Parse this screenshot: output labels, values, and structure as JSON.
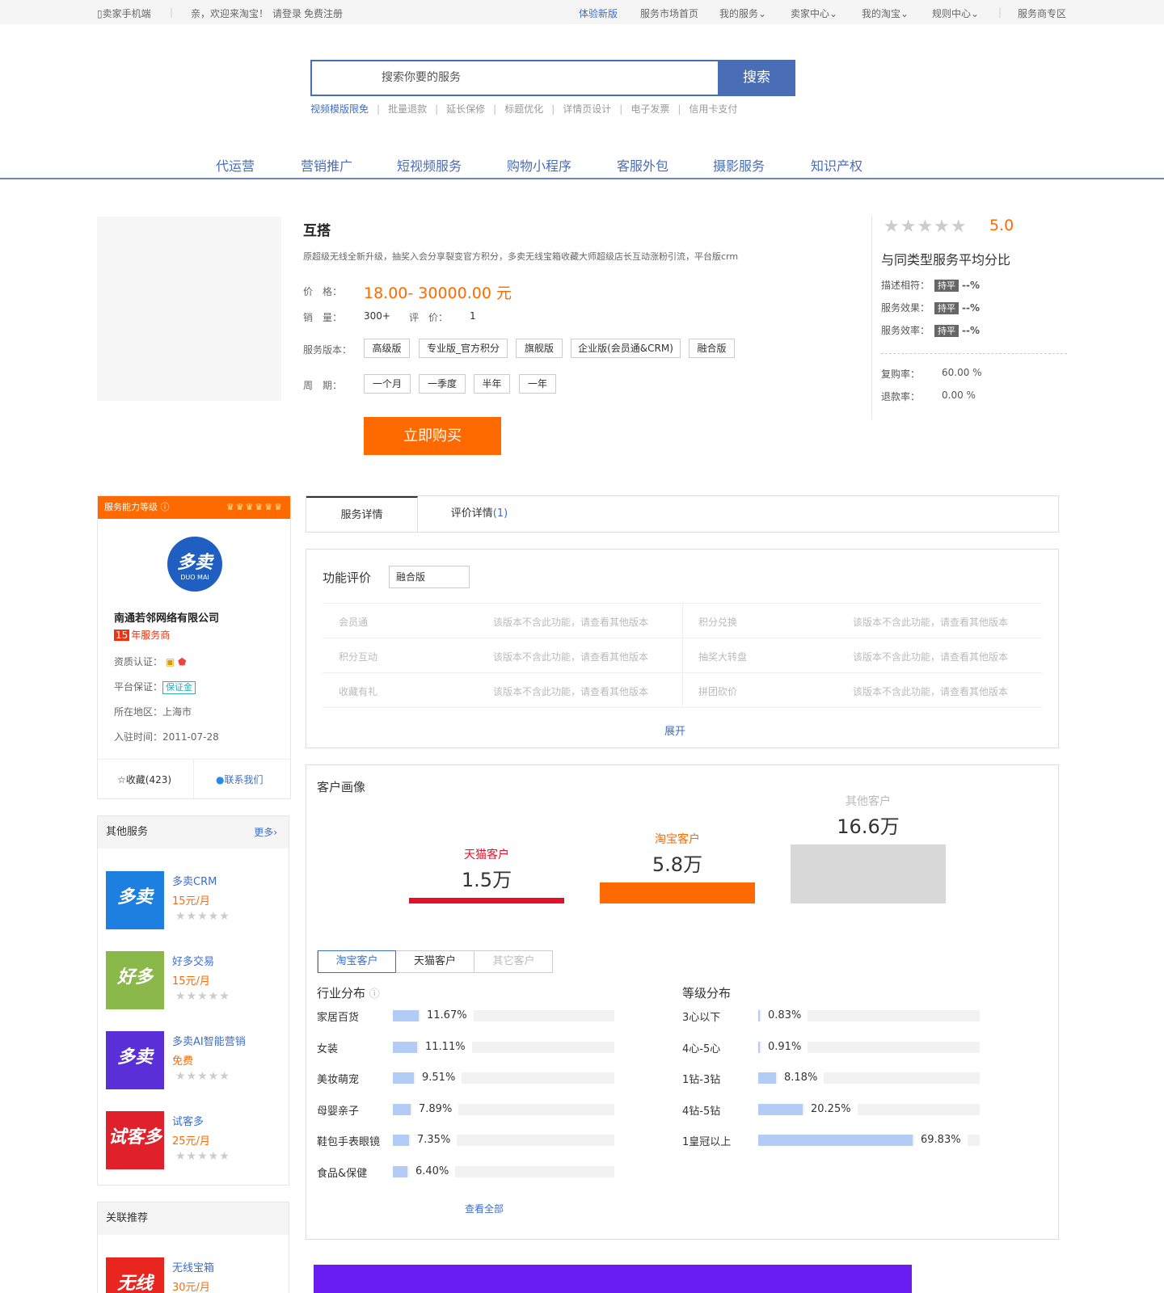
{
  "topbar": {
    "mobile": "卖家手机端",
    "welcome": "亲，欢迎来淘宝！",
    "login": "请登录",
    "register": "免费注册",
    "new_version": "体验新版",
    "market_home": "服务市场首页",
    "my_service": "我的服务",
    "seller_center": "卖家中心",
    "my_taobao": "我的淘宝",
    "rules": "规则中心",
    "provider_zone": "服务商专区"
  },
  "search": {
    "placeholder": "搜索你要的服务",
    "button": "搜索"
  },
  "hotwords": [
    "视频模版限免",
    "批量退款",
    "延长保修",
    "标题优化",
    "详情页设计",
    "电子发票",
    "信用卡支付"
  ],
  "categories": [
    "代运营",
    "营销推广",
    "短视频服务",
    "购物小程序",
    "客服外包",
    "摄影服务",
    "知识产权"
  ],
  "product": {
    "title": "互搭",
    "description": "原超级无线全新升级，抽奖入会分享裂变官方积分，多卖无线宝箱收藏大师超级店长互动涨粉引流，平台版crm",
    "price_label": "价　格：",
    "price": "18.00- 30000.00 元",
    "sales_label": "销　量：",
    "sales": "300+",
    "review_label": "评　价：",
    "reviews": "1",
    "version_label": "服务版本：",
    "versions": [
      "高级版",
      "专业版_官方积分",
      "旗舰版",
      "企业版(会员通&CRM)",
      "融合版"
    ],
    "period_label": "周　期：",
    "periods": [
      "一个月",
      "一季度",
      "半年",
      "一年"
    ],
    "buy_button": "立即购买"
  },
  "rating": {
    "stars": "★★★★★",
    "score": "5.0",
    "compare_title": "与同类型服务平均分比",
    "rows": [
      {
        "label": "描述相符：",
        "badge": "持平",
        "value": "--%"
      },
      {
        "label": "服务效果：",
        "badge": "持平",
        "value": "--%"
      },
      {
        "label": "服务效率：",
        "badge": "持平",
        "value": "--%"
      }
    ],
    "repurchase_label": "复购率：",
    "repurchase": "60.00 %",
    "refund_label": "退款率：",
    "refund": "0.00 %"
  },
  "provider": {
    "level_label": "服务能力等级",
    "logo_text": "多卖",
    "logo_sub": "DUO MAI",
    "company": "南通若邻网络有限公司",
    "years": "15",
    "years_suffix": "年服务商",
    "qualification_label": "资质认证：",
    "guarantee_label": "平台保证：",
    "guarantee_badge": "保证金",
    "region_label": "所在地区：",
    "region": "上海市",
    "joined_label": "入驻时间：",
    "joined": "2011-07-28",
    "favorite": "收藏(423)",
    "contact": "联系我们"
  },
  "other_services": {
    "title": "其他服务",
    "more": "更多›",
    "items": [
      {
        "name": "多卖CRM",
        "price": "15元/月",
        "stars": "★★★★★",
        "pic": "多卖",
        "color": "#1d7fe0"
      },
      {
        "name": "好多交易",
        "price": "15元/月",
        "stars": "★★★★★",
        "pic": "好多",
        "color": "#8ab84a"
      },
      {
        "name": "多卖AI智能营销",
        "price": "免费",
        "stars": "★★★★★",
        "pic": "多卖",
        "color": "#5a2fd8"
      },
      {
        "name": "试客多",
        "price": "25元/月",
        "stars": "★★★★★",
        "pic": "试客多",
        "color": "#e0202a"
      }
    ]
  },
  "related": {
    "title": "关联推荐",
    "items": [
      {
        "name": "无线宝箱",
        "price": "30元/月",
        "pic": "无线",
        "color": "#e8261f"
      }
    ]
  },
  "tabs": {
    "detail": "服务详情",
    "reviews": "评价详情",
    "review_count": "(1)"
  },
  "function_review": {
    "title": "功能评价",
    "selected_version": "融合版",
    "rows": [
      [
        {
          "name": "会员通",
          "note": "该版本不含此功能，请查看其他版本"
        },
        {
          "name": "积分兑换",
          "note": "该版本不含此功能，请查看其他版本"
        }
      ],
      [
        {
          "name": "积分互动",
          "note": "该版本不含此功能，请查看其他版本"
        },
        {
          "name": "抽奖大转盘",
          "note": "该版本不含此功能，请查看其他版本"
        }
      ],
      [
        {
          "name": "收藏有礼",
          "note": "该版本不含此功能，请查看其他版本"
        },
        {
          "name": "拼团砍价",
          "note": "该版本不含此功能，请查看其他版本"
        }
      ]
    ],
    "expand": "展开"
  },
  "persona": {
    "title": "客户画像",
    "tabs": [
      "淘宝客户",
      "天猫客户",
      "其它客户"
    ],
    "industry_title": "行业分布",
    "level_title": "等级分布",
    "view_all": "查看全部"
  },
  "colors": {
    "accent": "#ff6a00",
    "brand_blue": "#4a6eb5",
    "link": "#3b6ecf",
    "tmall_red": "#e60f28",
    "bar_blue": "#b3ccf5"
  },
  "chart_data": [
    {
      "type": "bar",
      "categories": [
        "天猫客户",
        "淘宝客户",
        "其他客户"
      ],
      "values": [
        1.5,
        5.8,
        16.6
      ],
      "value_labels": [
        "1.5万",
        "5.8万",
        "16.6万"
      ],
      "colors": [
        "#e60f28",
        "#ff6a00",
        "#d8d8d8"
      ],
      "label_colors": [
        "#e60f28",
        "#ff6a00",
        "#bbbbbb"
      ],
      "title": "",
      "xlabel": "",
      "ylabel": ""
    },
    {
      "type": "bar",
      "title": "行业分布",
      "categories": [
        "家居百货",
        "女装",
        "美妆萌宠",
        "母婴亲子",
        "鞋包手表眼镜",
        "食品&保健"
      ],
      "values": [
        11.67,
        11.11,
        9.51,
        7.89,
        7.35,
        6.4
      ],
      "value_labels": [
        "11.67%",
        "11.11%",
        "9.51%",
        "7.89%",
        "7.35%",
        "6.40%"
      ],
      "xlabel": "",
      "ylabel": ""
    },
    {
      "type": "bar",
      "title": "等级分布",
      "categories": [
        "3心以下",
        "4心-5心",
        "1钻-3钻",
        "4钻-5钻",
        "1皇冠以上"
      ],
      "values": [
        0.83,
        0.91,
        8.18,
        20.25,
        69.83
      ],
      "value_labels": [
        "0.83%",
        "0.91%",
        "8.18%",
        "20.25%",
        "69.83%"
      ],
      "xlabel": "",
      "ylabel": ""
    }
  ]
}
